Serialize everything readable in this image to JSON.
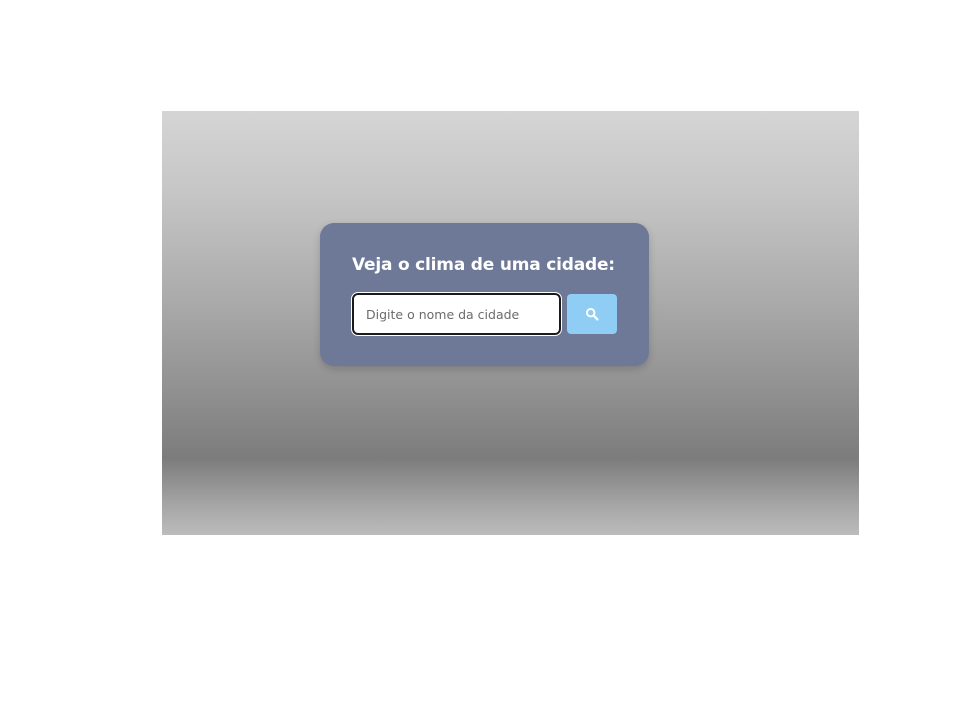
{
  "weather_card": {
    "title": "Veja o clima de uma cidade:",
    "city_input": {
      "value": "",
      "placeholder": "Digite o nome da cidade"
    },
    "search_button": {
      "icon": "search-icon"
    }
  },
  "colors": {
    "card_background": "#6e7897",
    "button_background": "#8fcdf4",
    "title_text": "#ffffff"
  }
}
